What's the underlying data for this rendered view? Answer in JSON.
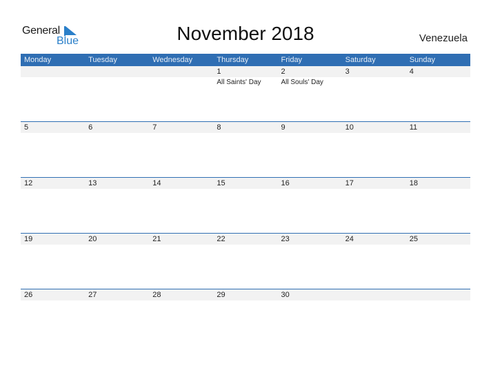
{
  "logo": {
    "general": "General",
    "blue": "Blue"
  },
  "title": "November 2018",
  "country": "Venezuela",
  "colors": {
    "header_bg": "#2f6eb3",
    "accent": "#2a7fc9",
    "strip_bg": "#f2f2f2"
  },
  "weekdays": [
    "Monday",
    "Tuesday",
    "Wednesday",
    "Thursday",
    "Friday",
    "Saturday",
    "Sunday"
  ],
  "weeks": [
    {
      "days": [
        "",
        "",
        "",
        "1",
        "2",
        "3",
        "4"
      ],
      "events": [
        "",
        "",
        "",
        "All Saints' Day",
        "All Souls' Day",
        "",
        ""
      ]
    },
    {
      "days": [
        "5",
        "6",
        "7",
        "8",
        "9",
        "10",
        "11"
      ],
      "events": [
        "",
        "",
        "",
        "",
        "",
        "",
        ""
      ]
    },
    {
      "days": [
        "12",
        "13",
        "14",
        "15",
        "16",
        "17",
        "18"
      ],
      "events": [
        "",
        "",
        "",
        "",
        "",
        "",
        ""
      ]
    },
    {
      "days": [
        "19",
        "20",
        "21",
        "22",
        "23",
        "24",
        "25"
      ],
      "events": [
        "",
        "",
        "",
        "",
        "",
        "",
        ""
      ]
    },
    {
      "days": [
        "26",
        "27",
        "28",
        "29",
        "30",
        "",
        ""
      ],
      "events": [
        "",
        "",
        "",
        "",
        "",
        "",
        ""
      ]
    }
  ]
}
